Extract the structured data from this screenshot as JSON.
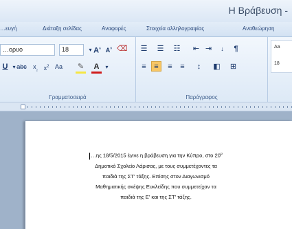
{
  "title": "Η Βράβευση - ",
  "tabs": [
    "…ευγή",
    "Διάταξη σελίδας",
    "Αναφορές",
    "Στοιχεία αλληλογραφίας",
    "Αναθεώρηση"
  ],
  "ribbon": {
    "font_name": "…ορυο",
    "font_size": "18",
    "font_group_label": "Γραμματοσειρά",
    "paragraph_group_label": "Παράγραφος",
    "style_preview_1": "Aa",
    "style_preview_2": "18"
  },
  "document": {
    "line1": "…ης 18/5/2015 έγινε η βράβευση για την Κύπρο, στο 20",
    "line1_sup": "ο",
    "line2": "Δημοτικό Σχολείο Λάρισας, με τους συμμετέχοντες τα",
    "line3": "παιδιά της ΣΤ' τάξης. Επίσης  στον Διαγωνισμό",
    "line4": "Μαθηματικής σκέψης Ευκλείδης που συμμετείχαν τα",
    "line5": "παιδιά της Ε' και της ΣΤ' τάξης."
  },
  "colors": {
    "accent": "#27467a",
    "highlight": "#f5e642",
    "font_red": "#d01b1b"
  }
}
